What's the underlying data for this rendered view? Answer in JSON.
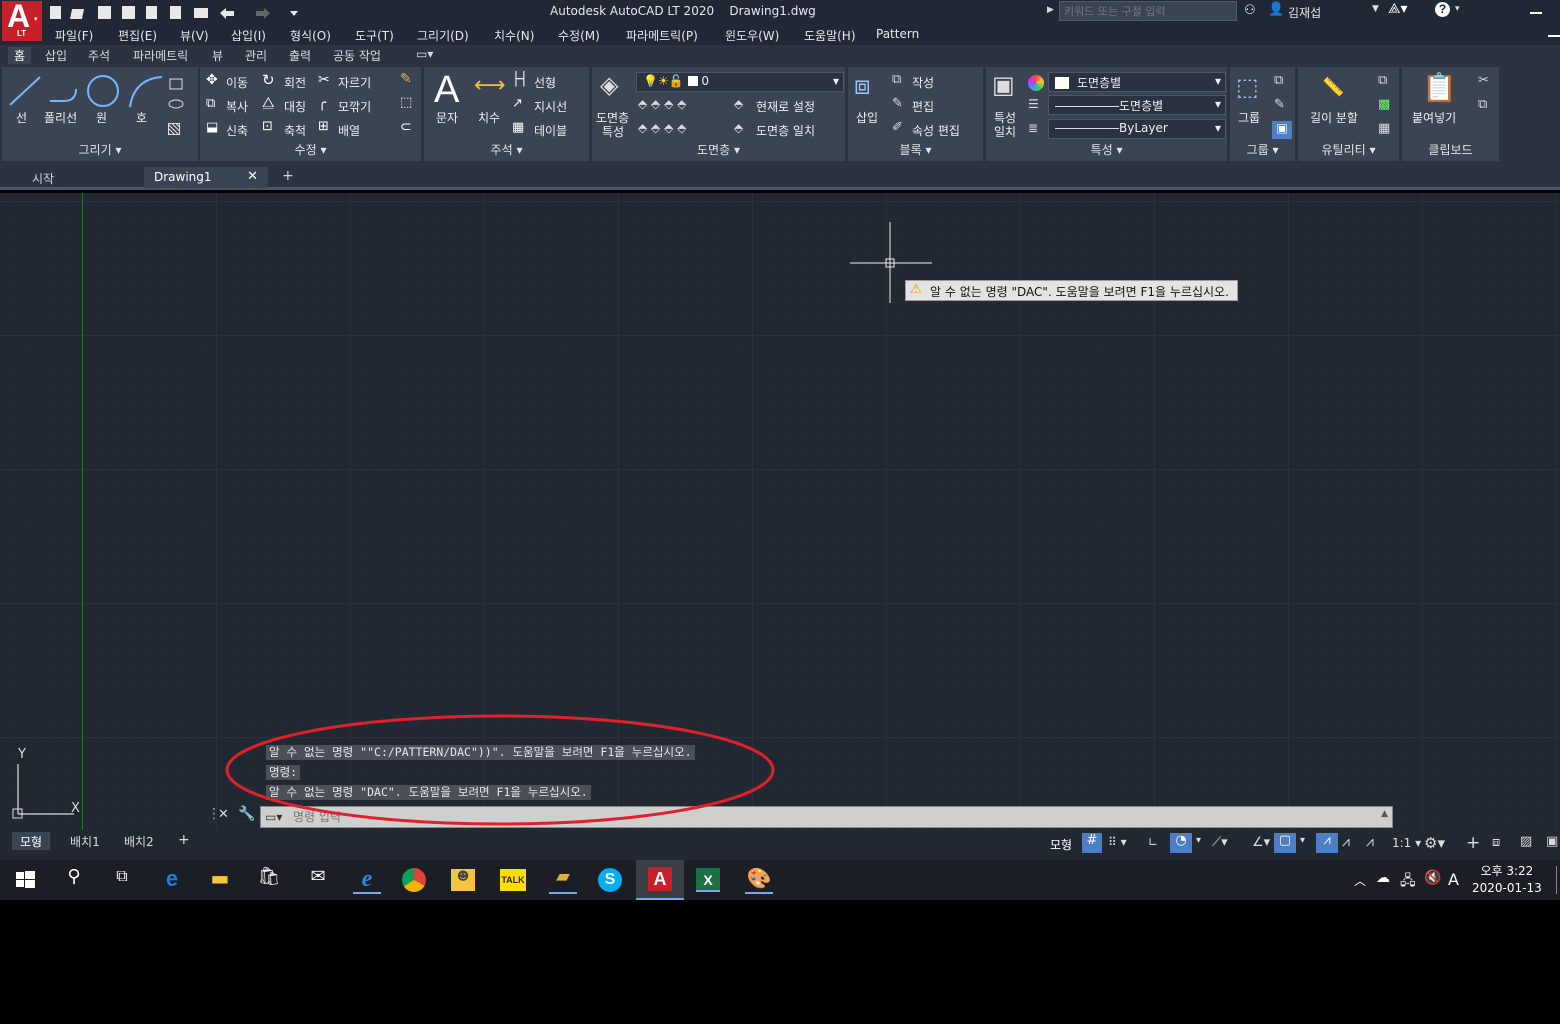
{
  "app": {
    "title": "Autodesk AutoCAD LT 2020",
    "file": "Drawing1.dwg",
    "logo_letter": "A",
    "logo_sub": "LT",
    "accent": "#c8202a"
  },
  "search": {
    "placeholder": "키워드 또는 구절 입력"
  },
  "user": {
    "name": "김재섭"
  },
  "menu": [
    "파일(F)",
    "편집(E)",
    "뷰(V)",
    "삽입(I)",
    "형식(O)",
    "도구(T)",
    "그리기(D)",
    "치수(N)",
    "수정(M)",
    "파라메트릭(P)",
    "윈도우(W)",
    "도움말(H)",
    "Pattern"
  ],
  "ribbon_tabs": [
    "홈",
    "삽입",
    "주석",
    "파라메트릭",
    "뷰",
    "관리",
    "출력",
    "공동 작업"
  ],
  "panels": {
    "draw": {
      "title": "그리기",
      "tools": [
        "선",
        "폴리선",
        "원",
        "호"
      ]
    },
    "modify": {
      "title": "수정",
      "tools": [
        "이동",
        "회전",
        "자르기",
        "복사",
        "대칭",
        "모깎기",
        "신축",
        "축척",
        "배열"
      ]
    },
    "annotation": {
      "title": "주석",
      "tools": [
        "문자",
        "치수",
        "선형",
        "지시선",
        "테이블"
      ]
    },
    "layers": {
      "title": "도면층",
      "props_label": [
        "도면층",
        "특성"
      ],
      "current_layer": "0",
      "set_current": "현재로 설정",
      "match_layer": "도면층 일치"
    },
    "block": {
      "title": "블록",
      "insert": "삽입",
      "create": "작성",
      "edit": "편집",
      "edit_attr": "속성 편집"
    },
    "properties": {
      "title": "특성",
      "match": [
        "특성",
        "일치"
      ],
      "color": "도면층별",
      "linetype": "도면층별",
      "lineweight": "ByLayer"
    },
    "groups": {
      "title": "그룹",
      "group": "그룹"
    },
    "utilities": {
      "title": "유틸리티",
      "measure": "길이 분할"
    },
    "clipboard": {
      "title": "클립보드",
      "paste": "붙여넣기"
    }
  },
  "doc_tabs": [
    {
      "label": "시작",
      "active": false
    },
    {
      "label": "Drawing1",
      "active": true
    }
  ],
  "tooltip": {
    "text": "알 수 없는 명령 \"DAC\". 도움말을 보려면 F1을 누르십시오."
  },
  "command_history": [
    "알 수 없는 명령 \"\"C:/PATTERN/DAC\"))\". 도움말을 보려면 F1을 누르십시오.",
    "명령:",
    "알 수 없는 명령 \"DAC\". 도움말을 보려면 F1을 누르십시오."
  ],
  "command_input": {
    "placeholder": "명령 입력"
  },
  "ucs": {
    "x": "X",
    "y": "Y"
  },
  "layout_tabs": [
    "모형",
    "배치1",
    "배치2"
  ],
  "status": {
    "model": "모형",
    "scale": "1:1"
  },
  "clock": {
    "time": "오후 3:22",
    "date": "2020-01-13"
  },
  "ime": "A",
  "highlight_color": "#e0202a"
}
